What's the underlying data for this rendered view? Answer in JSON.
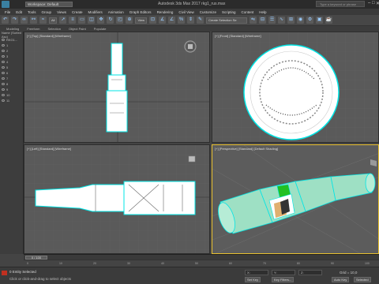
{
  "app": {
    "title": "Autodesk 3ds Max 2017    rkg1_rus.max",
    "workspace": "Workspace: Default",
    "search_placeholder": "Type a keyword or phrase",
    "win_controls": [
      "–",
      "□",
      "✕"
    ]
  },
  "menu": [
    "File",
    "Edit",
    "Tools",
    "Group",
    "Views",
    "Create",
    "Modifiers",
    "Animation",
    "Graph Editors",
    "Rendering",
    "Civil View",
    "Customize",
    "Scripting",
    "Content",
    "Help"
  ],
  "toolbar": {
    "filter": "All",
    "view": "View",
    "selection_set": "Create Selection Se"
  },
  "ribbon": [
    "Modeling",
    "Freeform",
    "Selection",
    "Object Paint",
    "Populate"
  ],
  "scene_explorer": {
    "rows": [
      "Name (Sorted Asc)",
      "RKG1...",
      "1",
      "2",
      "3",
      "4",
      "5",
      "6",
      "7",
      "8",
      "9",
      "10",
      "11"
    ]
  },
  "viewports": [
    {
      "label": "[+] [Top] [Standard] [Wireframe]"
    },
    {
      "label": "[+] [Front] [Standard] [Wireframe]"
    },
    {
      "label": "[+] [Left] [Standard] [Wireframe]"
    },
    {
      "label": "[+] [Perspective] [Standard] [Default Shading]"
    }
  ],
  "timeline": {
    "frame": "0 / 100",
    "ticks": [
      "0",
      "10",
      "20",
      "30",
      "40",
      "50",
      "60",
      "70",
      "80",
      "90",
      "100"
    ]
  },
  "status": {
    "selection": "0 Entity Selected",
    "prompt": "Click or click-and-drag to select objects",
    "x": "X:",
    "y": "Y:",
    "z": "Z:",
    "grid": "Grid = 10,0",
    "auto_key": "Auto Key",
    "selected": "Selected",
    "set_key": "Set Key",
    "key_filters": "Key Filters..."
  },
  "colors": {
    "accent": "#e8c030",
    "wire": "#00e5e5",
    "model": "#9ee0c4",
    "highlight": "#22c022"
  }
}
